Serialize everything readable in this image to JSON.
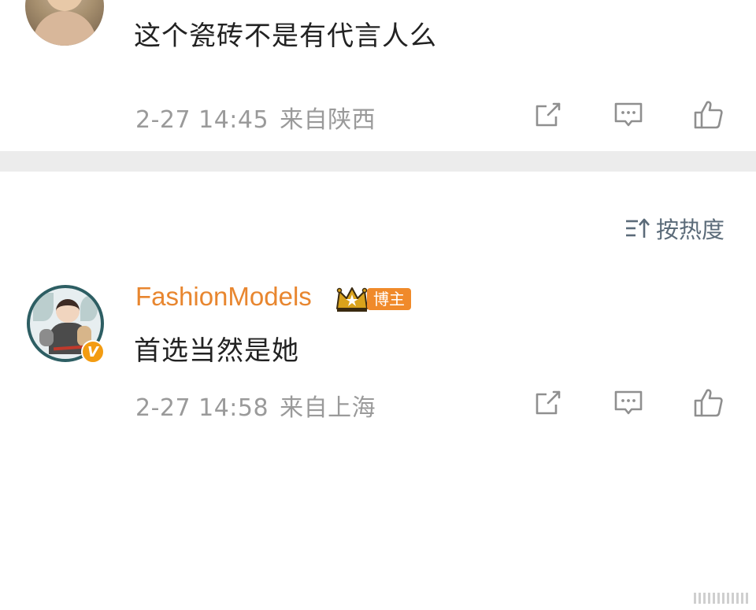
{
  "comments": [
    {
      "text": "这个瓷砖不是有代言人么",
      "time": "2-27 14:45",
      "location": "来自陕西"
    },
    {
      "username": "FashionModels",
      "badge": "博主",
      "text": "首选当然是她",
      "time": "2-27 14:58",
      "location": "来自上海"
    }
  ],
  "sort": {
    "label": "按热度"
  },
  "icons": {
    "share": "share-icon",
    "reply": "comment-icon",
    "like": "thumbs-up-icon",
    "sort": "sort-icon",
    "crown": "crown-icon",
    "verified": "verified-icon"
  },
  "colors": {
    "username": "#e8862f",
    "badge": "#f08a2a",
    "meta": "#9a9a9a",
    "sort": "#5b6b79",
    "separator": "#ececec"
  }
}
